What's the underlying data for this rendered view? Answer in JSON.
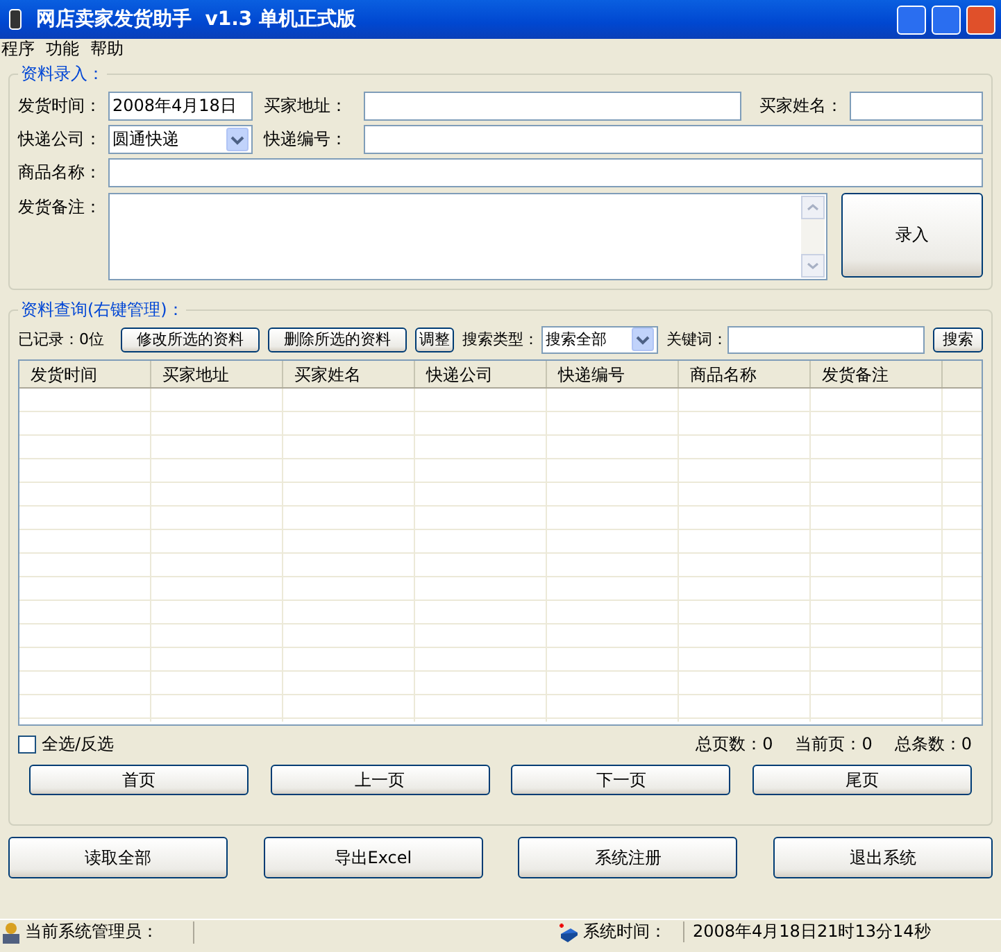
{
  "window": {
    "title": "网店卖家发货助手  v1.3 单机正式版"
  },
  "menu": [
    "程序",
    "功能",
    "帮助"
  ],
  "entry": {
    "legend": "资料录入：",
    "ship_time": {
      "label": "发货时间：",
      "value": "2008年4月18日"
    },
    "buyer_address": {
      "label": "买家地址："
    },
    "buyer_name": {
      "label": "买家姓名："
    },
    "courier": {
      "label": "快递公司：",
      "value": "圆通快递"
    },
    "tracking_no": {
      "label": "快递编号："
    },
    "product_name": {
      "label": "商品名称："
    },
    "remarks": {
      "label": "发货备注："
    },
    "submit_button": "录入"
  },
  "query": {
    "legend": "资料查询(右键管理)：",
    "record_count": "已记录：0位",
    "buttons": [
      "修改所选的资料",
      "删除所选的资料",
      "调整"
    ],
    "search_type": {
      "label": "搜索类型：",
      "value": "搜索全部"
    },
    "keyword": {
      "label": "关键词："
    },
    "search_button": "搜索",
    "table": {
      "columns": [
        "发货时间",
        "买家地址",
        "买家姓名",
        "快递公司",
        "快递编号",
        "商品名称",
        "发货备注"
      ]
    },
    "select_all": {
      "label": "全选/反选",
      "checked": false
    },
    "pager_info": [
      "总页数：0",
      "当前页：0",
      "总条数：0"
    ],
    "pager_buttons": [
      "首页",
      "上一页",
      "下一页",
      "尾页"
    ]
  },
  "actions": [
    "读取全部",
    "导出Excel",
    "系统注册",
    "退出系统"
  ],
  "status_bar": {
    "admin_label": "当前系统管理员：",
    "time_label": "系统时间：",
    "time_value": "2008年4月18日21时13分14秒"
  }
}
